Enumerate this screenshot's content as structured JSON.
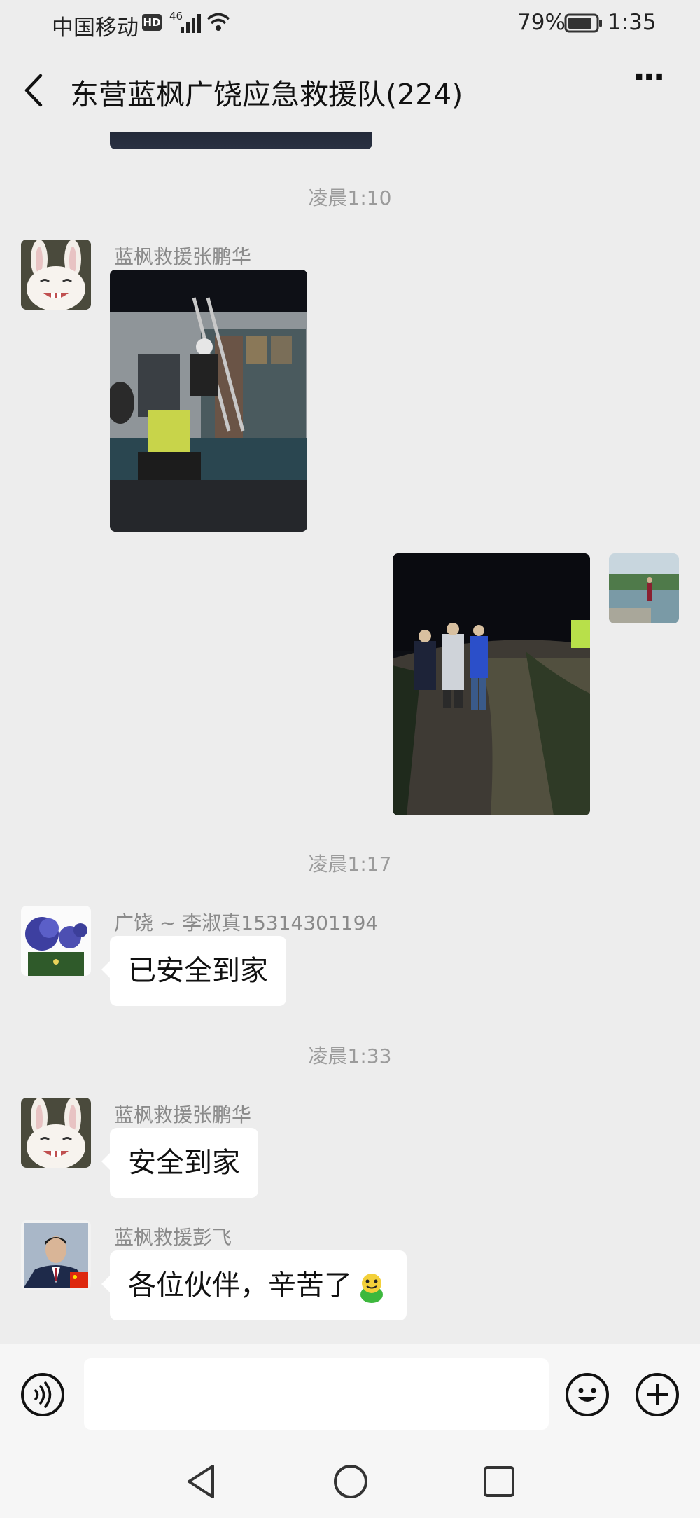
{
  "status_bar": {
    "carrier": "中国移动",
    "hd": "HD",
    "network": "46",
    "battery": "79%",
    "time": "1:35"
  },
  "nav": {
    "title": "东营蓝枫广饶应急救援队(224)",
    "more": "···"
  },
  "messages": {
    "time1": "凌晨1:10",
    "msg1_sender": "蓝枫救援张鹏华",
    "time2": "凌晨1:17",
    "msg3_sender": "广饶 ~ 李淑真15314301194",
    "msg3_text": "已安全到家",
    "time3": "凌晨1:33",
    "msg4_sender": "蓝枫救援张鹏华",
    "msg4_text": "安全到家",
    "msg5_sender": "蓝枫救援彭飞",
    "msg5_text": "各位伙伴，辛苦了"
  },
  "colors": {
    "background": "#ededed",
    "bubble": "#ffffff",
    "meta_text": "#9b9b9b"
  },
  "icons": [
    "back-icon",
    "more-icon",
    "voice-icon",
    "emoji-icon",
    "plus-icon",
    "nav-back-icon",
    "nav-home-icon",
    "nav-recents-icon"
  ]
}
